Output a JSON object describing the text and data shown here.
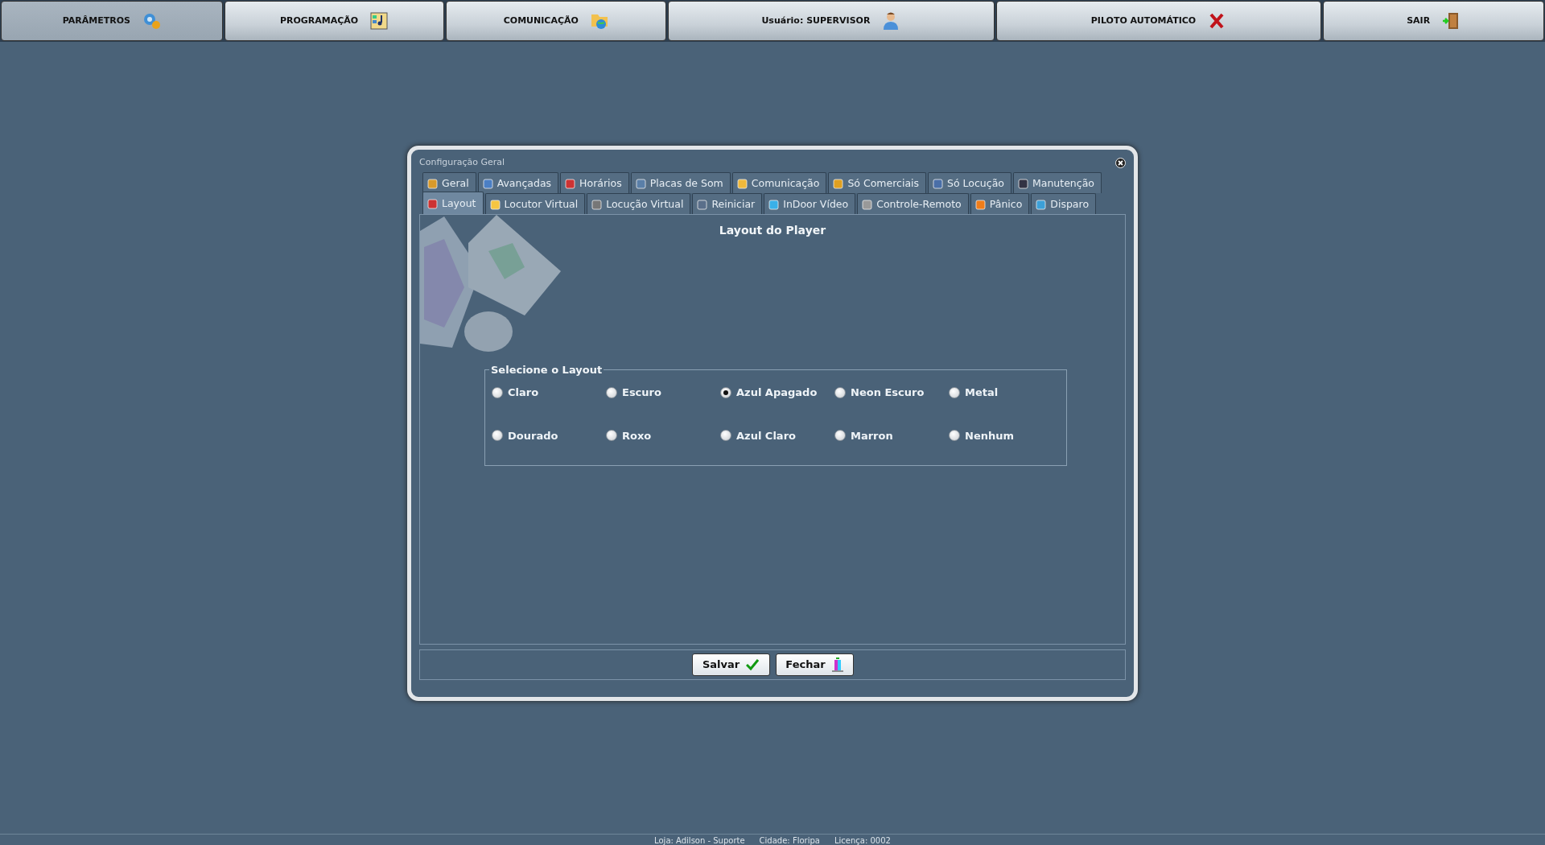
{
  "top_menu": [
    {
      "label": "PARÂMETROS",
      "selected": true
    },
    {
      "label": "PROGRAMAÇÃO",
      "selected": false
    },
    {
      "label": "COMUNICAÇÃO",
      "selected": false
    },
    {
      "label": "Usuário: SUPERVISOR",
      "selected": false
    },
    {
      "label": "PILOTO AUTOMÁTICO",
      "selected": false
    },
    {
      "label": "SAIR",
      "selected": false
    }
  ],
  "dialog": {
    "title": "Configuração Geral",
    "tab_rows": [
      [
        {
          "label": "Geral",
          "selected": false
        },
        {
          "label": "Avançadas",
          "selected": false
        },
        {
          "label": "Horários",
          "selected": false
        },
        {
          "label": "Placas de Som",
          "selected": false
        },
        {
          "label": "Comunicação",
          "selected": false
        },
        {
          "label": "Só Comerciais",
          "selected": false
        },
        {
          "label": "Só Locução",
          "selected": false
        },
        {
          "label": "Manutenção",
          "selected": false
        }
      ],
      [
        {
          "label": "Layout",
          "selected": true
        },
        {
          "label": "Locutor Virtual",
          "selected": false
        },
        {
          "label": "Locução Virtual",
          "selected": false
        },
        {
          "label": "Reiniciar",
          "selected": false
        },
        {
          "label": "InDoor Vídeo",
          "selected": false
        },
        {
          "label": "Controle-Remoto",
          "selected": false
        },
        {
          "label": "Pânico",
          "selected": false
        },
        {
          "label": "Disparo",
          "selected": false
        }
      ]
    ],
    "heading": "Layout do Player",
    "group_title": "Selecione o Layout",
    "options": [
      {
        "label": "Claro",
        "selected": false
      },
      {
        "label": "Escuro",
        "selected": false
      },
      {
        "label": "Azul Apagado",
        "selected": true
      },
      {
        "label": "Neon Escuro",
        "selected": false
      },
      {
        "label": "Metal",
        "selected": false
      },
      {
        "label": "Dourado",
        "selected": false
      },
      {
        "label": "Roxo",
        "selected": false
      },
      {
        "label": "Azul Claro",
        "selected": false
      },
      {
        "label": "Marron",
        "selected": false
      },
      {
        "label": "Nenhum",
        "selected": false
      }
    ],
    "buttons": [
      {
        "label": "Salvar"
      },
      {
        "label": "Fechar"
      }
    ]
  },
  "status_bar": [
    "Loja: Adilson - Suporte",
    "Cidade: Floripa",
    "Licença: 0002"
  ]
}
